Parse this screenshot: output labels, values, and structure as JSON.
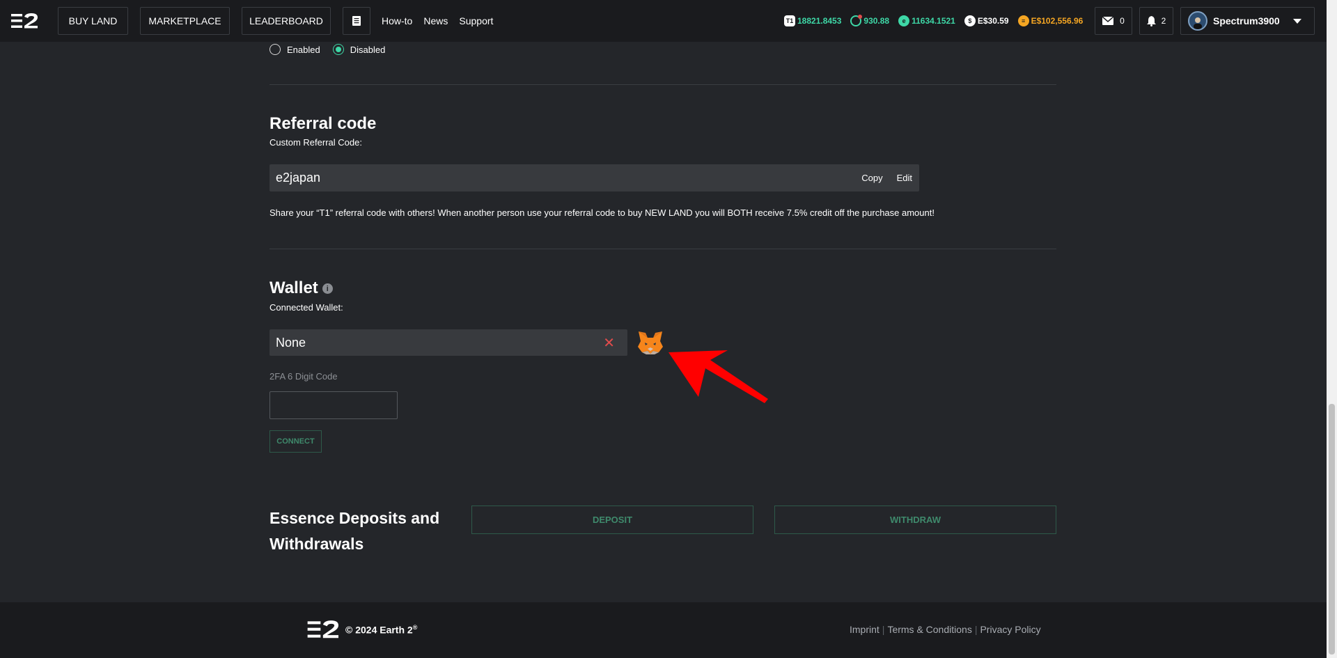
{
  "nav": {
    "buy_land": "BUY LAND",
    "marketplace": "MARKETPLACE",
    "leaderboard": "LEADERBOARD",
    "howto": "How-to",
    "news": "News",
    "support": "Support"
  },
  "balances": {
    "tiles": "18821.8453",
    "tiles_badge": "T1",
    "jewels": "930.88",
    "essence": "11634.1521",
    "cash": "E$30.59",
    "gold": "E$102,556.96",
    "colors": {
      "green": "#3ed8a7",
      "white": "#ffffff",
      "gold": "#f5a623"
    }
  },
  "notifications": {
    "mail_count": "0",
    "bell_count": "2"
  },
  "user": {
    "name": "Spectrum3900"
  },
  "account": {
    "radio_enabled": "Enabled",
    "radio_disabled": "Disabled",
    "selected": "Disabled"
  },
  "referral": {
    "title": "Referral code",
    "label": "Custom Referral Code:",
    "value": "e2japan",
    "copy": "Copy",
    "edit": "Edit",
    "description": "Share your “T1” referral code with others! When another person use your referral code to buy NEW LAND you will BOTH receive 7.5% credit off the purchase amount!"
  },
  "wallet": {
    "title": "Wallet",
    "info_icon": "i",
    "label": "Connected Wallet:",
    "value": "None",
    "clear_icon": "✕",
    "twofa_label": "2FA 6 Digit Code",
    "twofa_value": "",
    "connect": "CONNECT"
  },
  "essence": {
    "title": "Essence Deposits and Withdrawals",
    "deposit": "DEPOSIT",
    "withdraw": "WITHDRAW"
  },
  "footer": {
    "copyright": "© 2024 Earth 2",
    "reg": "®",
    "imprint": "Imprint",
    "terms": "Terms & Conditions",
    "privacy": "Privacy Policy"
  }
}
